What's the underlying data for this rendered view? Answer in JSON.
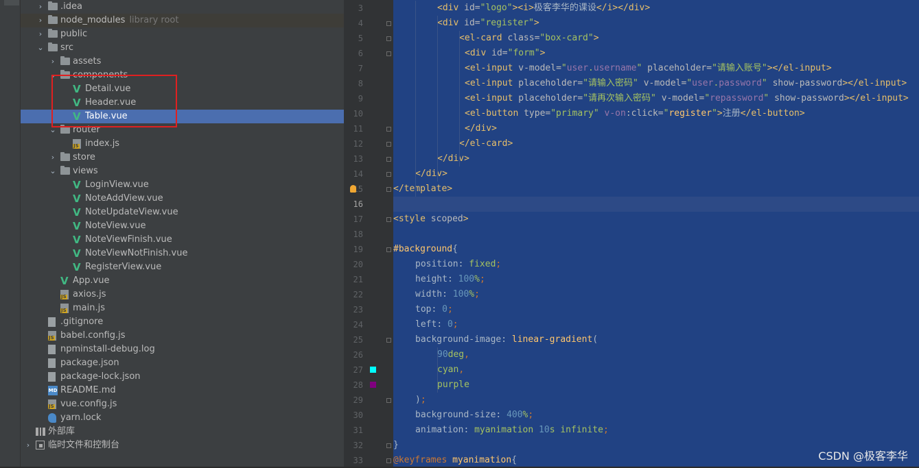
{
  "project_tree": {
    "rows": [
      {
        "label": ".idea",
        "hint": "",
        "icon": "folder-icon",
        "arrow": "›",
        "selected": false
      },
      {
        "label": "node_modules",
        "hint": "library root",
        "icon": "folder-icon",
        "arrow": "›",
        "selected": false
      },
      {
        "label": "public",
        "hint": "",
        "icon": "folder-icon",
        "arrow": "›",
        "selected": false
      },
      {
        "label": "src",
        "hint": "",
        "icon": "folder-icon",
        "arrow": "⌄",
        "selected": false
      },
      {
        "label": "assets",
        "hint": "",
        "icon": "folder-icon",
        "arrow": "›",
        "selected": false
      },
      {
        "label": "components",
        "hint": "",
        "icon": "folder-icon",
        "arrow": "⌄",
        "selected": false
      },
      {
        "label": "Detail.vue",
        "hint": "",
        "icon": "vue-icon",
        "arrow": "",
        "selected": false
      },
      {
        "label": "Header.vue",
        "hint": "",
        "icon": "vue-icon",
        "arrow": "",
        "selected": false
      },
      {
        "label": "Table.vue",
        "hint": "",
        "icon": "vue-icon",
        "arrow": "",
        "selected": true
      },
      {
        "label": "router",
        "hint": "",
        "icon": "folder-icon",
        "arrow": "⌄",
        "selected": false
      },
      {
        "label": "index.js",
        "hint": "",
        "icon": "js-file-icon",
        "arrow": "",
        "selected": false
      },
      {
        "label": "store",
        "hint": "",
        "icon": "folder-icon",
        "arrow": "›",
        "selected": false
      },
      {
        "label": "views",
        "hint": "",
        "icon": "folder-icon",
        "arrow": "⌄",
        "selected": false
      },
      {
        "label": "LoginView.vue",
        "hint": "",
        "icon": "vue-icon",
        "arrow": "",
        "selected": false
      },
      {
        "label": "NoteAddView.vue",
        "hint": "",
        "icon": "vue-icon",
        "arrow": "",
        "selected": false
      },
      {
        "label": "NoteUpdateView.vue",
        "hint": "",
        "icon": "vue-icon",
        "arrow": "",
        "selected": false
      },
      {
        "label": "NoteView.vue",
        "hint": "",
        "icon": "vue-icon",
        "arrow": "",
        "selected": false
      },
      {
        "label": "NoteViewFinish.vue",
        "hint": "",
        "icon": "vue-icon",
        "arrow": "",
        "selected": false
      },
      {
        "label": "NoteViewNotFinish.vue",
        "hint": "",
        "icon": "vue-icon",
        "arrow": "",
        "selected": false
      },
      {
        "label": "RegisterView.vue",
        "hint": "",
        "icon": "vue-icon",
        "arrow": "",
        "selected": false
      },
      {
        "label": "App.vue",
        "hint": "",
        "icon": "vue-icon",
        "arrow": "",
        "selected": false
      },
      {
        "label": "axios.js",
        "hint": "",
        "icon": "js-file-icon",
        "arrow": "",
        "selected": false
      },
      {
        "label": "main.js",
        "hint": "",
        "icon": "js-file-icon",
        "arrow": "",
        "selected": false
      },
      {
        "label": ".gitignore",
        "hint": "",
        "icon": "file-icon",
        "arrow": "",
        "selected": false
      },
      {
        "label": "babel.config.js",
        "hint": "",
        "icon": "js-file-icon",
        "arrow": "",
        "selected": false
      },
      {
        "label": "npminstall-debug.log",
        "hint": "",
        "icon": "file-icon",
        "arrow": "",
        "selected": false
      },
      {
        "label": "package.json",
        "hint": "",
        "icon": "file-icon",
        "arrow": "",
        "selected": false
      },
      {
        "label": "package-lock.json",
        "hint": "",
        "icon": "file-icon",
        "arrow": "",
        "selected": false
      },
      {
        "label": "README.md",
        "hint": "",
        "icon": "markdown-icon",
        "arrow": "",
        "selected": false
      },
      {
        "label": "vue.config.js",
        "hint": "",
        "icon": "js-file-icon",
        "arrow": "",
        "selected": false
      },
      {
        "label": "yarn.lock",
        "hint": "",
        "icon": "yarn-icon",
        "arrow": "",
        "selected": false
      },
      {
        "label": "外部库",
        "hint": "",
        "icon": "library-icon",
        "arrow": "",
        "selected": false
      },
      {
        "label": "临时文件和控制台",
        "hint": "",
        "icon": "scratch-icon",
        "arrow": "›",
        "selected": false
      }
    ]
  },
  "editor": {
    "current_line": "16",
    "lines": [
      {
        "num": "3",
        "indent": 2,
        "tokens": [
          [
            "t",
            "<div "
          ],
          [
            "a",
            "id="
          ],
          [
            "s",
            "\"logo\""
          ],
          [
            "t",
            "><i>"
          ],
          [
            "vo",
            "极客李华的课设"
          ],
          [
            "t",
            "</i></div>"
          ]
        ]
      },
      {
        "num": "4",
        "indent": 2,
        "tokens": [
          [
            "t",
            "<div "
          ],
          [
            "a",
            "id="
          ],
          [
            "s",
            "\"register\""
          ],
          [
            "t",
            ">"
          ]
        ]
      },
      {
        "num": "5",
        "indent": 3,
        "tokens": [
          [
            "t",
            "<el-card "
          ],
          [
            "a",
            "class="
          ],
          [
            "s",
            "\"box-card\""
          ],
          [
            "t",
            ">"
          ]
        ]
      },
      {
        "num": "6",
        "indent": 3.25,
        "tokens": [
          [
            "t",
            "<div "
          ],
          [
            "a",
            "id="
          ],
          [
            "s",
            "\"form\""
          ],
          [
            "t",
            ">"
          ]
        ]
      },
      {
        "num": "7",
        "indent": 3.25,
        "tokens": [
          [
            "t",
            "<el-input "
          ],
          [
            "a",
            "v-model="
          ],
          [
            "s",
            "\""
          ],
          [
            "p",
            "user"
          ],
          [
            "s",
            "."
          ],
          [
            "p",
            "username"
          ],
          [
            "s",
            "\" "
          ],
          [
            "a",
            "placeholder="
          ],
          [
            "s",
            "\"请输入账号\""
          ],
          [
            "t",
            "></el-input>"
          ]
        ]
      },
      {
        "num": "8",
        "indent": 3.25,
        "tokens": [
          [
            "t",
            "<el-input "
          ],
          [
            "a",
            "placeholder="
          ],
          [
            "s",
            "\"请输入密码\" "
          ],
          [
            "a",
            "v-model="
          ],
          [
            "s",
            "\""
          ],
          [
            "p",
            "user"
          ],
          [
            "s",
            "."
          ],
          [
            "p",
            "password"
          ],
          [
            "s",
            "\" "
          ],
          [
            "a",
            "show-password"
          ],
          [
            "t",
            "></el-input>"
          ]
        ]
      },
      {
        "num": "9",
        "indent": 3.25,
        "tokens": [
          [
            "t",
            "<el-input "
          ],
          [
            "a",
            "placeholder="
          ],
          [
            "s",
            "\"请再次输入密码\" "
          ],
          [
            "a",
            "v-model="
          ],
          [
            "s",
            "\""
          ],
          [
            "p",
            "repassword"
          ],
          [
            "s",
            "\" "
          ],
          [
            "a",
            "show-password"
          ],
          [
            "t",
            "></el-input>"
          ]
        ]
      },
      {
        "num": "10",
        "indent": 3.25,
        "tokens": [
          [
            "t",
            "<el-button "
          ],
          [
            "a",
            "type="
          ],
          [
            "s",
            "\"primary\" "
          ],
          [
            "p",
            "v-on"
          ],
          [
            "a",
            ":click="
          ],
          [
            "s",
            "\""
          ],
          [
            "f",
            "register"
          ],
          [
            "s",
            "\""
          ],
          [
            "t",
            ">"
          ],
          [
            "vo",
            "注册"
          ],
          [
            "t",
            "</el-button>"
          ]
        ]
      },
      {
        "num": "11",
        "indent": 3.25,
        "tokens": [
          [
            "t",
            "</div>"
          ]
        ]
      },
      {
        "num": "12",
        "indent": 3,
        "tokens": [
          [
            "t",
            "</el-card>"
          ]
        ]
      },
      {
        "num": "13",
        "indent": 2,
        "tokens": [
          [
            "t",
            "</div>"
          ]
        ]
      },
      {
        "num": "14",
        "indent": 1,
        "tokens": [
          [
            "t",
            "</div>"
          ]
        ]
      },
      {
        "num": "15",
        "indent": 0,
        "tokens": [
          [
            "t",
            "</template>"
          ]
        ]
      },
      {
        "num": "16",
        "indent": 0,
        "tokens": []
      },
      {
        "num": "17",
        "indent": 0,
        "tokens": [
          [
            "t",
            "<style "
          ],
          [
            "a",
            "scoped"
          ],
          [
            "t",
            ">"
          ]
        ]
      },
      {
        "num": "18",
        "indent": 0,
        "tokens": []
      },
      {
        "num": "19",
        "indent": 0,
        "tokens": [
          [
            "f",
            "#background"
          ],
          [
            "vo",
            "{"
          ]
        ]
      },
      {
        "num": "20",
        "indent": 1,
        "tokens": [
          [
            "vo",
            "position"
          ],
          [
            "vo",
            ": "
          ],
          [
            "s",
            "fixed"
          ],
          [
            "k",
            ";"
          ]
        ]
      },
      {
        "num": "21",
        "indent": 1,
        "tokens": [
          [
            "vo",
            "height"
          ],
          [
            "vo",
            ": "
          ],
          [
            "n",
            "100"
          ],
          [
            "s",
            "%"
          ],
          [
            "k",
            ";"
          ]
        ]
      },
      {
        "num": "22",
        "indent": 1,
        "tokens": [
          [
            "vo",
            "width"
          ],
          [
            "vo",
            ": "
          ],
          [
            "n",
            "100"
          ],
          [
            "s",
            "%"
          ],
          [
            "k",
            ";"
          ]
        ]
      },
      {
        "num": "23",
        "indent": 1,
        "tokens": [
          [
            "vo",
            "top"
          ],
          [
            "vo",
            ": "
          ],
          [
            "n",
            "0"
          ],
          [
            "k",
            ";"
          ]
        ]
      },
      {
        "num": "24",
        "indent": 1,
        "tokens": [
          [
            "vo",
            "left"
          ],
          [
            "vo",
            ": "
          ],
          [
            "n",
            "0"
          ],
          [
            "k",
            ";"
          ]
        ]
      },
      {
        "num": "25",
        "indent": 1,
        "tokens": [
          [
            "vo",
            "background-image"
          ],
          [
            "vo",
            ": "
          ],
          [
            "f",
            "linear-gradient"
          ],
          [
            "vo",
            "("
          ]
        ]
      },
      {
        "num": "26",
        "indent": 2,
        "tokens": [
          [
            "n",
            "90"
          ],
          [
            "s",
            "deg"
          ],
          [
            "k",
            ","
          ]
        ]
      },
      {
        "num": "27",
        "indent": 2,
        "tokens": [
          [
            "s",
            "cyan"
          ],
          [
            "k",
            ","
          ]
        ]
      },
      {
        "num": "28",
        "indent": 2,
        "tokens": [
          [
            "s",
            "purple"
          ]
        ]
      },
      {
        "num": "29",
        "indent": 1,
        "tokens": [
          [
            "vo",
            ")"
          ],
          [
            "k",
            ";"
          ]
        ]
      },
      {
        "num": "30",
        "indent": 1,
        "tokens": [
          [
            "vo",
            "background-size"
          ],
          [
            "vo",
            ": "
          ],
          [
            "n",
            "400"
          ],
          [
            "s",
            "%"
          ],
          [
            "k",
            ";"
          ]
        ]
      },
      {
        "num": "31",
        "indent": 1,
        "tokens": [
          [
            "vo",
            "animation"
          ],
          [
            "vo",
            ": "
          ],
          [
            "s",
            "myanimation "
          ],
          [
            "n",
            "10"
          ],
          [
            "s",
            "s infinite"
          ],
          [
            "k",
            ";"
          ]
        ]
      },
      {
        "num": "32",
        "indent": 0,
        "tokens": [
          [
            "vo",
            "}"
          ]
        ]
      },
      {
        "num": "33",
        "indent": 0,
        "tokens": [
          [
            "k",
            "@keyframes "
          ],
          [
            "f",
            "myanimation"
          ],
          [
            "vo",
            "{"
          ]
        ]
      }
    ],
    "color_swatches": [
      {
        "line": "27",
        "color": "#00ffff"
      },
      {
        "line": "28",
        "color": "#800080"
      }
    ]
  },
  "watermark": "CSDN @极客李华"
}
